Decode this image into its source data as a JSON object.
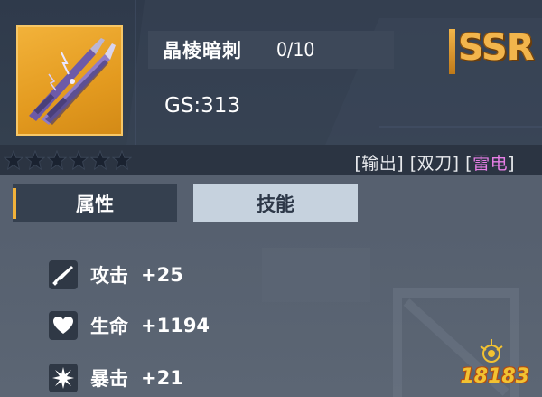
{
  "item": {
    "name": "晶棱暗刺",
    "level": "0/10",
    "gs": "GS:313",
    "rarity": "SSR",
    "icon": "twin-blade-icon",
    "stars": 6
  },
  "tags": {
    "role": "[输出]",
    "weapon": "[双刀]",
    "element_open": "[",
    "element": "雷电",
    "element_close": "]"
  },
  "tabs": {
    "attributes": "属性",
    "skills": "技能",
    "active": "attributes"
  },
  "stats": [
    {
      "icon": "sword-icon",
      "label": "攻击",
      "value": "+25"
    },
    {
      "icon": "heart-icon",
      "label": "生命",
      "value": "+1194"
    },
    {
      "icon": "burst-icon",
      "label": "暴击",
      "value": "+21"
    }
  ],
  "watermark": {
    "text": "18183"
  },
  "colors": {
    "rarity_gold": "#f2b54c",
    "thunder_purple": "#e77ee6",
    "tab_active": "#35404f",
    "tab_inactive": "#c6d2de"
  }
}
